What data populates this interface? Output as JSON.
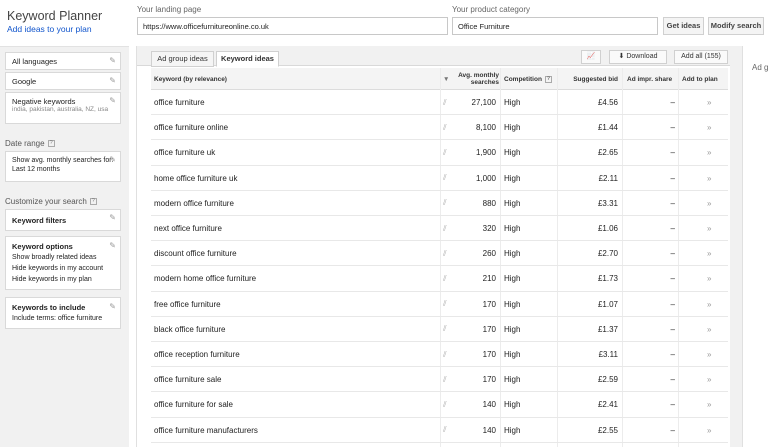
{
  "header": {
    "app_title": "Keyword Planner",
    "app_subtitle": "Add ideas to your plan",
    "landing_page_label": "Your landing page",
    "landing_page_value": "https://www.officefurnitureonline.co.uk",
    "product_category_label": "Your product category",
    "product_category_value": "Office Furniture",
    "get_ideas_label": "Get ideas",
    "modify_search_label": "Modify search"
  },
  "sidebar": {
    "languages": "All languages",
    "search_engine": "Google",
    "negative_keywords_title": "Negative keywords",
    "negative_keywords_value": "india, pakistan, australia, NZ, usa",
    "date_range_label": "Date range",
    "date_range_value": "Show avg. monthly searches for: Last 12 months",
    "customize_label": "Customize your search",
    "keyword_filters_title": "Keyword filters",
    "keyword_options_title": "Keyword options",
    "keyword_options_items": [
      "Show broadly related ideas",
      "Hide keywords in my account",
      "Hide keywords in my plan"
    ],
    "keywords_include_title": "Keywords to include",
    "keywords_include_value": "Include terms: office furniture"
  },
  "tabs": {
    "ad_group_ideas": "Ad group ideas",
    "keyword_ideas": "Keyword ideas"
  },
  "toolbar": {
    "download_label": "Download",
    "add_all_label": "Add all (155)",
    "chart_icon": "chart-icon",
    "download_icon": "download-icon"
  },
  "table": {
    "headers": {
      "keyword": "Keyword (by relevance)",
      "avg_searches": "Avg. monthly searches",
      "competition": "Competition",
      "suggested_bid": "Suggested bid",
      "ad_impr_share": "Ad impr. share",
      "add_to_plan": "Add to plan"
    },
    "rows": [
      {
        "keyword": "office furniture",
        "searches": "27,100",
        "competition": "High",
        "bid": "£4.56",
        "share": "–"
      },
      {
        "keyword": "office furniture online",
        "searches": "8,100",
        "competition": "High",
        "bid": "£1.44",
        "share": "–"
      },
      {
        "keyword": "office furniture uk",
        "searches": "1,900",
        "competition": "High",
        "bid": "£2.65",
        "share": "–"
      },
      {
        "keyword": "home office furniture uk",
        "searches": "1,000",
        "competition": "High",
        "bid": "£2.11",
        "share": "–"
      },
      {
        "keyword": "modern office furniture",
        "searches": "880",
        "competition": "High",
        "bid": "£3.31",
        "share": "–"
      },
      {
        "keyword": "next office furniture",
        "searches": "320",
        "competition": "High",
        "bid": "£1.06",
        "share": "–"
      },
      {
        "keyword": "discount office furniture",
        "searches": "260",
        "competition": "High",
        "bid": "£2.70",
        "share": "–"
      },
      {
        "keyword": "modern home office furniture",
        "searches": "210",
        "competition": "High",
        "bid": "£1.73",
        "share": "–"
      },
      {
        "keyword": "free office furniture",
        "searches": "170",
        "competition": "High",
        "bid": "£1.07",
        "share": "–"
      },
      {
        "keyword": "black office furniture",
        "searches": "170",
        "competition": "High",
        "bid": "£1.37",
        "share": "–"
      },
      {
        "keyword": "office reception furniture",
        "searches": "170",
        "competition": "High",
        "bid": "£3.11",
        "share": "–"
      },
      {
        "keyword": "office furniture sale",
        "searches": "170",
        "competition": "High",
        "bid": "£2.59",
        "share": "–"
      },
      {
        "keyword": "office furniture for sale",
        "searches": "140",
        "competition": "High",
        "bid": "£2.41",
        "share": "–"
      },
      {
        "keyword": "office furniture manufacturers",
        "searches": "140",
        "competition": "High",
        "bid": "£2.55",
        "share": "–"
      }
    ]
  },
  "right_panel": {
    "label": "Ad g"
  }
}
